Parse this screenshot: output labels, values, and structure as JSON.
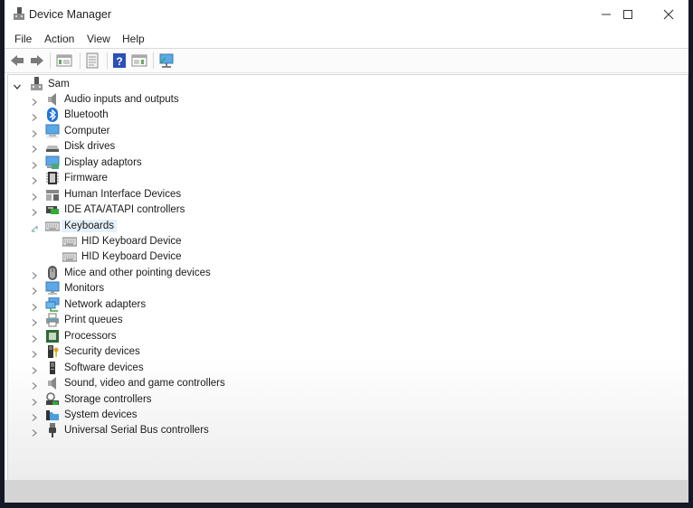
{
  "window": {
    "title": "Device Manager",
    "controls": {
      "minimize": "minimize",
      "maximize": "maximize",
      "close": "close"
    }
  },
  "menu": [
    "File",
    "Action",
    "View",
    "Help"
  ],
  "toolbar": {
    "buttons": [
      "back",
      "forward",
      "show-hide-console-tree",
      "properties",
      "help",
      "action-pane",
      "scan-hardware"
    ]
  },
  "tree": {
    "root": "Sam",
    "categories": [
      {
        "label": "Audio inputs and outputs",
        "icon": "speaker-icon",
        "expanded": false
      },
      {
        "label": "Bluetooth",
        "icon": "bluetooth-icon",
        "expanded": false
      },
      {
        "label": "Computer",
        "icon": "computer-icon",
        "expanded": false
      },
      {
        "label": "Disk drives",
        "icon": "disk-drive-icon",
        "expanded": false
      },
      {
        "label": "Display adaptors",
        "icon": "display-adapter-icon",
        "expanded": false
      },
      {
        "label": "Firmware",
        "icon": "firmware-icon",
        "expanded": false
      },
      {
        "label": "Human Interface Devices",
        "icon": "hid-icon",
        "expanded": false
      },
      {
        "label": "IDE ATA/ATAPI controllers",
        "icon": "ide-controller-icon",
        "expanded": false
      },
      {
        "label": "Keyboards",
        "icon": "keyboard-icon",
        "expanded": true,
        "selected": true,
        "children": [
          "HID Keyboard Device",
          "HID Keyboard Device"
        ]
      },
      {
        "label": "Mice and other pointing devices",
        "icon": "mouse-icon",
        "expanded": false
      },
      {
        "label": "Monitors",
        "icon": "monitor-icon",
        "expanded": false
      },
      {
        "label": "Network adapters",
        "icon": "network-adapter-icon",
        "expanded": false
      },
      {
        "label": "Print queues",
        "icon": "printer-icon",
        "expanded": false
      },
      {
        "label": "Processors",
        "icon": "processor-icon",
        "expanded": false
      },
      {
        "label": "Security devices",
        "icon": "security-device-icon",
        "expanded": false
      },
      {
        "label": "Software devices",
        "icon": "software-device-icon",
        "expanded": false
      },
      {
        "label": "Sound, video and game controllers",
        "icon": "sound-controller-icon",
        "expanded": false
      },
      {
        "label": "Storage controllers",
        "icon": "storage-controller-icon",
        "expanded": false
      },
      {
        "label": "System devices",
        "icon": "system-devices-icon",
        "expanded": false
      },
      {
        "label": "Universal Serial Bus controllers",
        "icon": "usb-icon",
        "expanded": false
      }
    ]
  },
  "colors": {
    "selection": "#e5f1fb",
    "accent": "#1e73d6"
  }
}
